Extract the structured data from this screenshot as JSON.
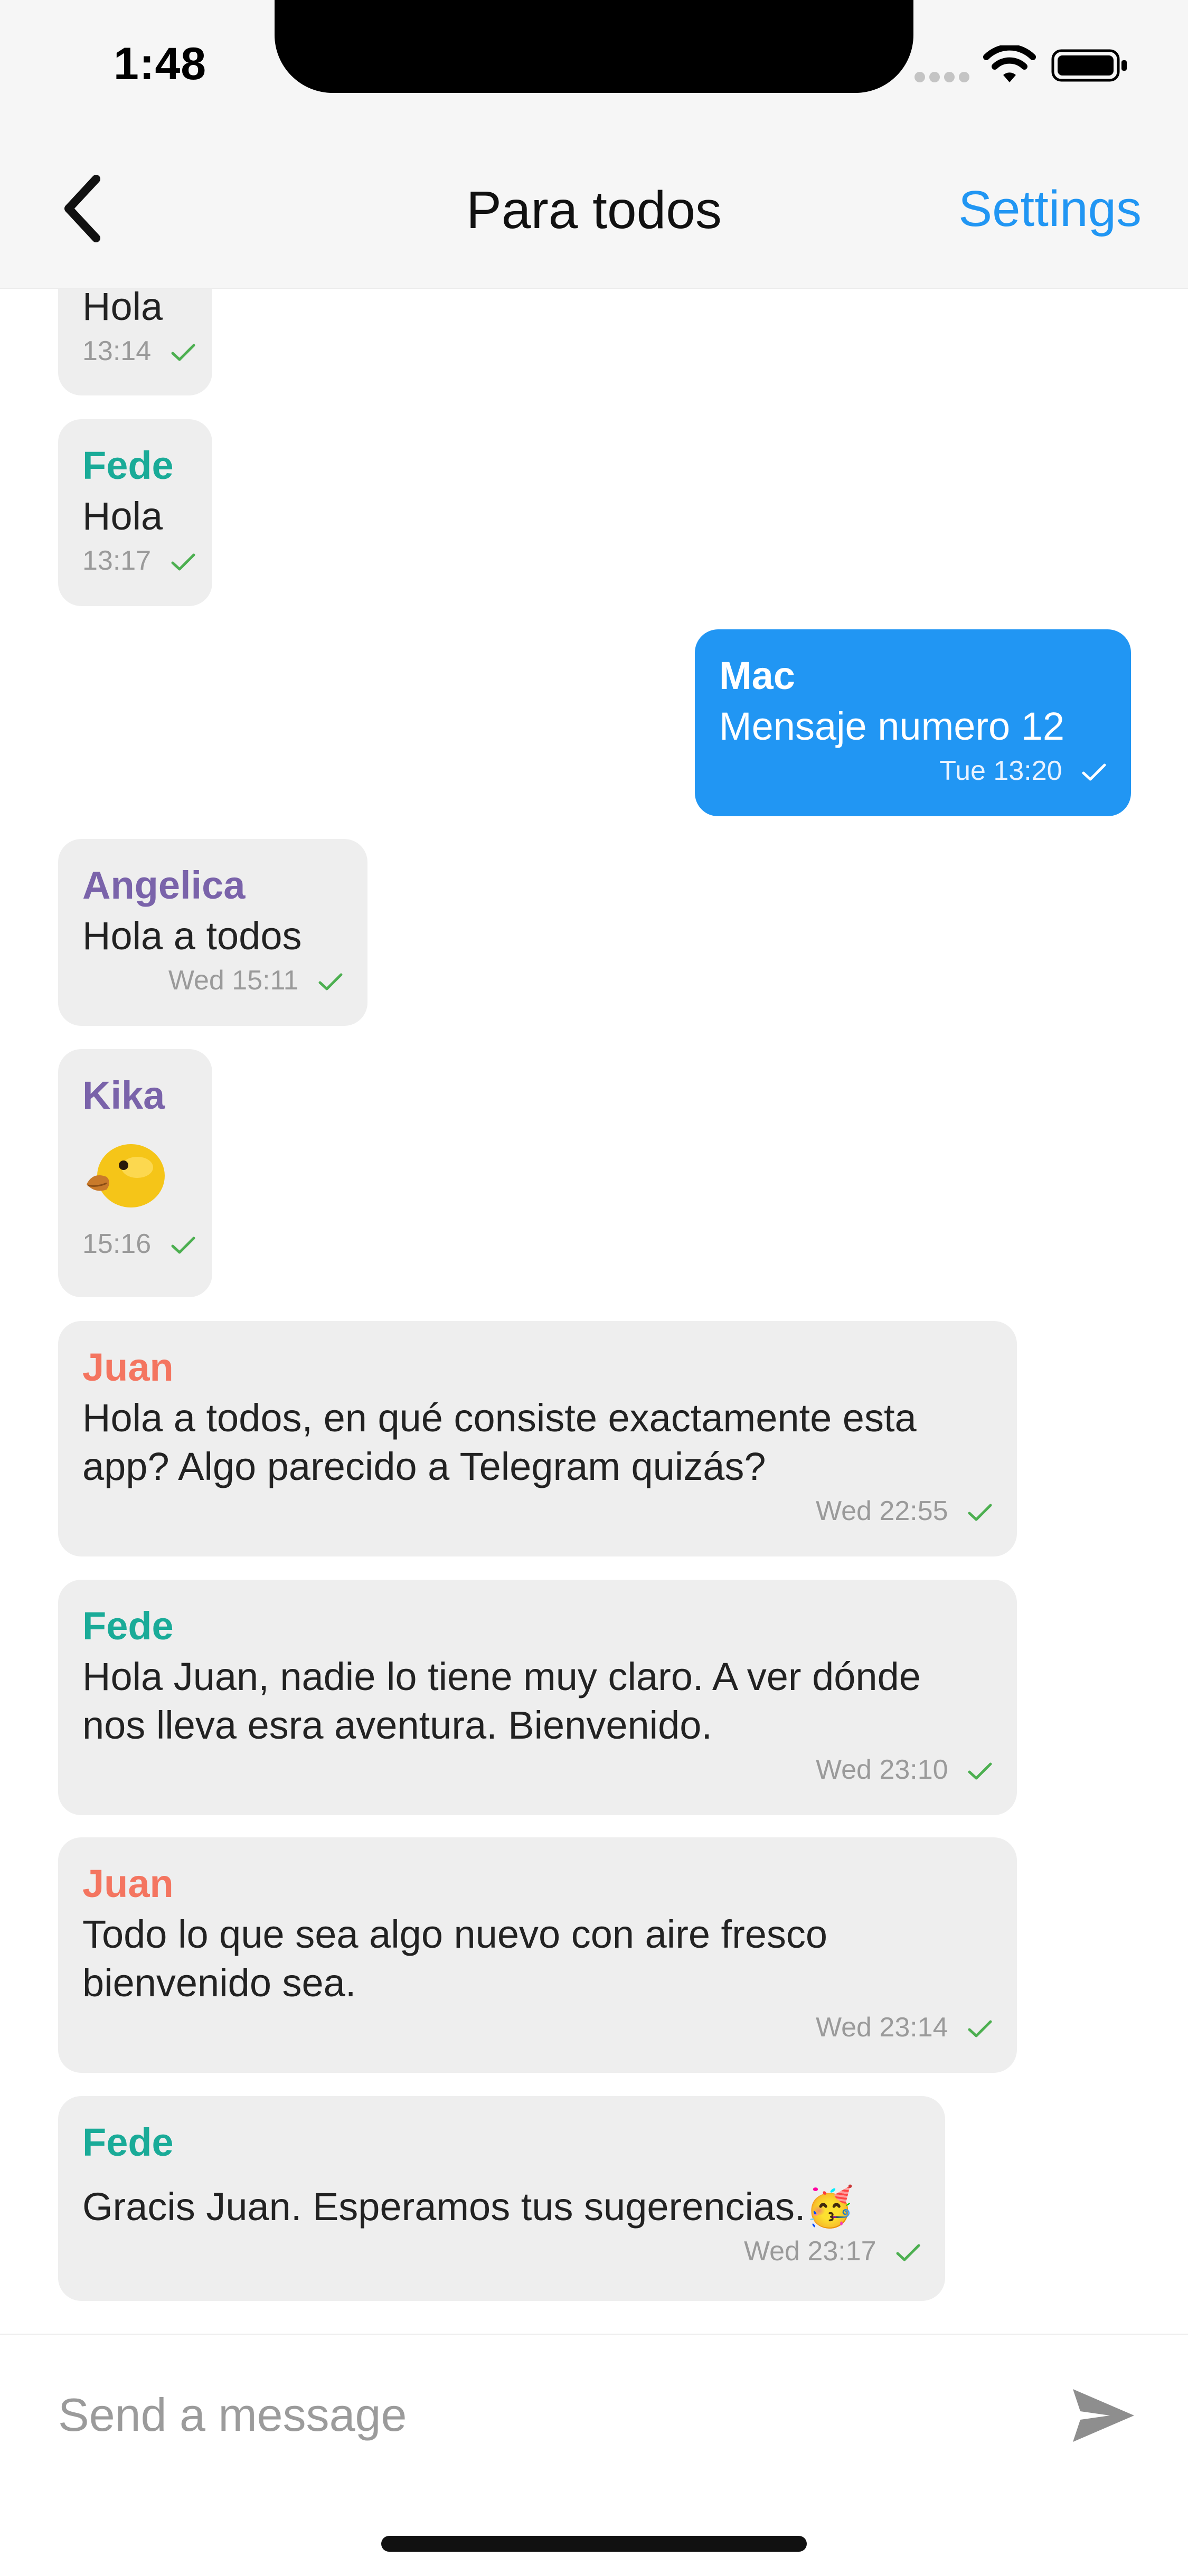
{
  "status_bar": {
    "time": "1:48"
  },
  "nav": {
    "title": "Para todos",
    "settings_label": "Settings"
  },
  "colors": {
    "accent": "#2196f3",
    "bubble_other": "#eeeeee",
    "check": "#4caf50",
    "name_fede": "#1aab98",
    "name_angelica": "#7a63aa",
    "name_kika": "#7a63aa",
    "name_juan": "#f47560",
    "name_mac": "#ffffff"
  },
  "messages": [
    {
      "sender": "",
      "text": "Hola",
      "time": "13:14",
      "status_icon": "check-icon",
      "mine": false
    },
    {
      "sender": "Fede",
      "text": "Hola",
      "time": "13:17",
      "status_icon": "check-icon",
      "mine": false
    },
    {
      "sender": "Mac",
      "text": "Mensaje numero 12",
      "time": "Tue 13:20",
      "status_icon": "check-icon",
      "mine": true
    },
    {
      "sender": "Angelica",
      "text": "Hola a todos",
      "time": "Wed 15:11",
      "status_icon": "check-icon",
      "mine": false
    },
    {
      "sender": "Kika",
      "text": "",
      "emoji": "duck-emoji",
      "time": "15:16",
      "status_icon": "check-icon",
      "mine": false
    },
    {
      "sender": "Juan",
      "text": "Hola a todos, en qué consiste exactamente esta app? Algo parecido a Telegram quizás?",
      "time": "Wed 22:55",
      "status_icon": "check-icon",
      "mine": false
    },
    {
      "sender": "Fede",
      "text": "Hola Juan, nadie lo tiene muy claro. A ver dónde nos lleva esra aventura. Bienvenido.",
      "time": "Wed 23:10",
      "status_icon": "check-icon",
      "mine": false
    },
    {
      "sender": "Juan",
      "text": "Todo lo que sea algo nuevo con aire fresco bienvenido sea.",
      "time": "Wed 23:14",
      "status_icon": "check-icon",
      "mine": false
    },
    {
      "sender": "Fede",
      "text": "Gracis Juan. Esperamos tus sugerencias.🥳",
      "time": "Wed 23:17",
      "status_icon": "check-icon",
      "mine": false
    }
  ],
  "composer": {
    "placeholder": "Send a message",
    "send_icon": "send-icon"
  }
}
